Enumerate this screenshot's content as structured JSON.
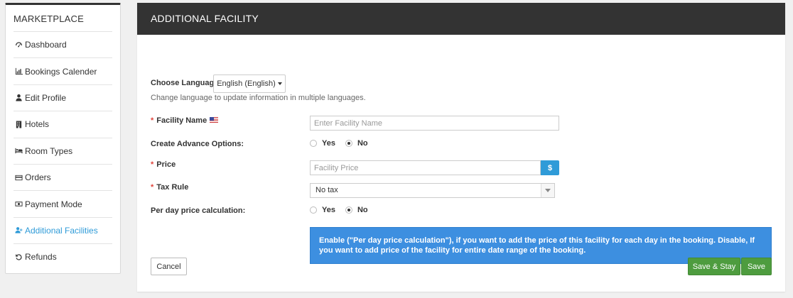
{
  "sidebar": {
    "title": "MARKETPLACE",
    "items": [
      {
        "label": "Dashboard",
        "icon": "dashboard-icon"
      },
      {
        "label": "Bookings Calender",
        "icon": "bar-chart-icon"
      },
      {
        "label": "Edit Profile",
        "icon": "user-icon"
      },
      {
        "label": "Hotels",
        "icon": "building-icon"
      },
      {
        "label": "Room Types",
        "icon": "bed-icon"
      },
      {
        "label": "Orders",
        "icon": "credit-card-icon"
      },
      {
        "label": "Payment Mode",
        "icon": "money-icon"
      },
      {
        "label": "Additional Facilities",
        "icon": "user-plus-icon",
        "active": true
      },
      {
        "label": "Refunds",
        "icon": "undo-icon"
      }
    ],
    "active_color": "#2f9bd8"
  },
  "panel": {
    "title": "ADDITIONAL FACILITY",
    "language_label": "Choose Language:",
    "language_value": "English (English)",
    "language_help": "Change language to update information in multiple languages.",
    "facility_name_label": "Facility Name",
    "facility_name_placeholder": "Enter Facility Name",
    "advance_options_label": "Create Advance Options:",
    "advance_options": {
      "yes": "Yes",
      "no": "No",
      "selected": "No"
    },
    "price_label": "Price",
    "price_placeholder": "Facility Price",
    "currency_symbol": "$",
    "tax_rule_label": "Tax Rule",
    "tax_rule_value": "No tax",
    "per_day_label": "Per day price calculation:",
    "per_day_options": {
      "yes": "Yes",
      "no": "No",
      "selected": "No"
    },
    "info_text": "Enable (\"Per day price calculation\"), if you want to add the price of this facility for each day in the booking. Disable, If you want to add price of the facility for entire date range of the booking."
  },
  "buttons": {
    "cancel": "Cancel",
    "save_stay": "Save & Stay",
    "save": "Save"
  },
  "colors": {
    "header_bg": "#333333",
    "primary_blue": "#2f9bd8",
    "info_blue": "#3d8fe0",
    "save_green": "#4e9c3f",
    "required_red": "#e0453c"
  }
}
